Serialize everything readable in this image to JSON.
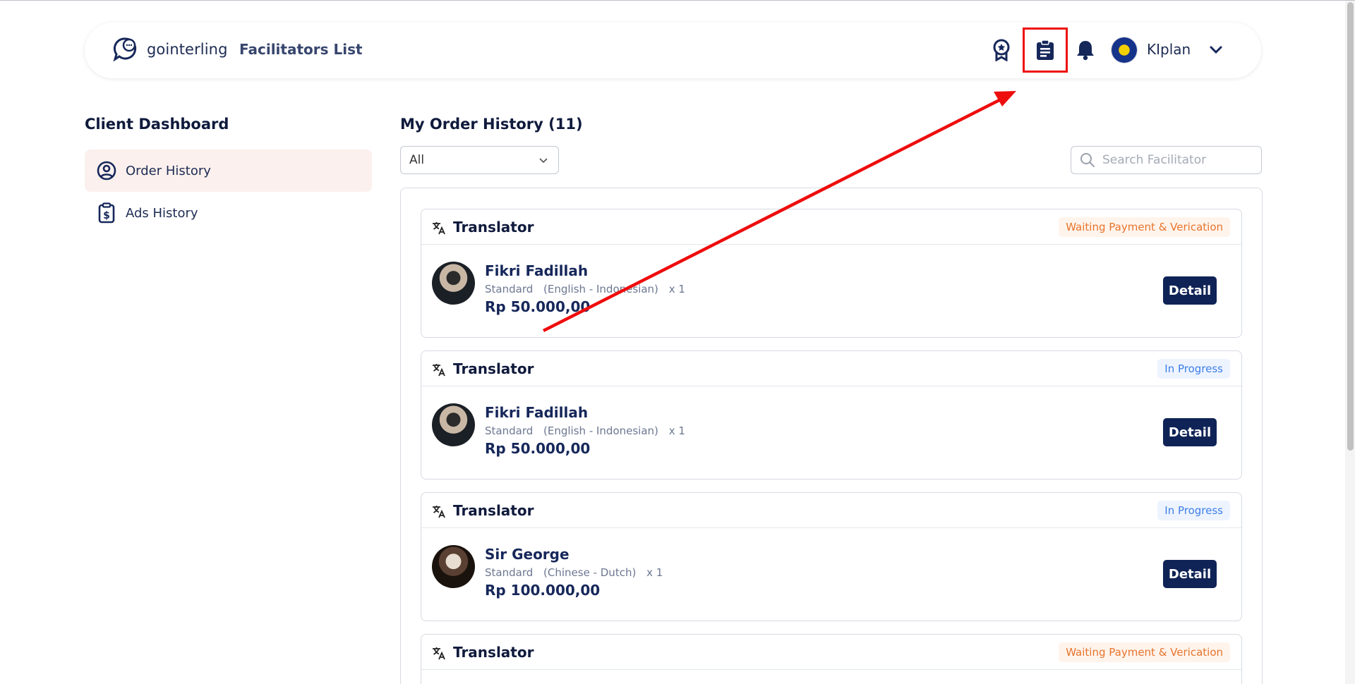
{
  "header": {
    "brand": "gointerling",
    "nav_link": "Facilitators List",
    "user_name": "KIplan",
    "icons": [
      "award-icon",
      "order-list-icon",
      "bell-icon",
      "chevron-down-icon"
    ]
  },
  "sidebar": {
    "title": "Client Dashboard",
    "items": [
      {
        "label": "Order History",
        "icon": "user-circle-icon",
        "active": true
      },
      {
        "label": "Ads History",
        "icon": "dollar-clipboard-icon",
        "active": false
      }
    ]
  },
  "main": {
    "title": "My Order History (11)",
    "filter_value": "All",
    "search_placeholder": "Search Facilitator",
    "orders": [
      {
        "service": "Translator",
        "status": "Waiting Payment & Verication",
        "name": "Fikri Fadillah",
        "package": "Standard",
        "languages": "(English - Indonesian)",
        "qty": "x 1",
        "price": "Rp 50.000,00",
        "button": "Detail"
      },
      {
        "service": "Translator",
        "status": "In Progress",
        "name": "Fikri Fadillah",
        "package": "Standard",
        "languages": "(English - Indonesian)",
        "qty": "x 1",
        "price": "Rp 50.000,00",
        "button": "Detail"
      },
      {
        "service": "Translator",
        "status": "In Progress",
        "name": "Sir George",
        "package": "Standard",
        "languages": "(Chinese - Dutch)",
        "qty": "x 1",
        "price": "Rp 100.000,00",
        "button": "Detail"
      },
      {
        "service": "Translator",
        "status": "Waiting Payment & Verication"
      }
    ]
  },
  "colors": {
    "navy": "#0f2356",
    "active_bg": "#fbf0ed",
    "waiting": "#e8742c",
    "progress": "#3d7ee8",
    "annotation": "#ee0d0d"
  }
}
